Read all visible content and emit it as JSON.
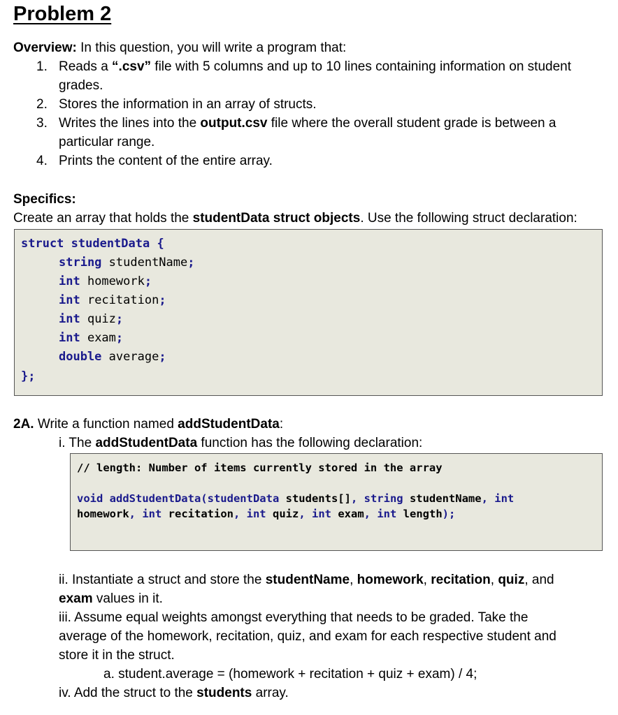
{
  "title": "Problem 2",
  "overview": {
    "label": "Overview:",
    "intro": " In this question, you will write a program that:",
    "items": [
      {
        "num": "1.",
        "pre": "Reads a ",
        "bold": "“.csv”",
        "post": " file with 5 columns and up to 10 lines containing information on student",
        "cont": "grades."
      },
      {
        "num": "2.",
        "text": "Stores the information in an array of structs."
      },
      {
        "num": "3.",
        "pre": "Writes the lines into the ",
        "bold": "output.csv",
        "post": " file where the overall student grade is between a",
        "cont": "particular range."
      },
      {
        "num": "4.",
        "text": "Prints the content of the entire array."
      }
    ]
  },
  "specifics": {
    "label": "Specifics:",
    "pre": "Create an array that holds the ",
    "bold": "studentData struct objects",
    "post": ". Use the following struct declaration:"
  },
  "struct_code": {
    "open_kw": "struct studentData {",
    "fields": [
      {
        "type": "string",
        "name": " studentName",
        "semi": ";"
      },
      {
        "type": "int",
        "name": " homework",
        "semi": ";"
      },
      {
        "type": "int",
        "name": " recitation",
        "semi": ";"
      },
      {
        "type": "int",
        "name": " quiz",
        "semi": ";"
      },
      {
        "type": "int",
        "name": " exam",
        "semi": ";"
      },
      {
        "type": "double",
        "name": " average",
        "semi": ";"
      }
    ],
    "close": "};"
  },
  "part_2a": {
    "label": "2A.",
    "pre": " Write a function named ",
    "bold": "addStudentData",
    "post": ":",
    "i": {
      "pre": "i. The ",
      "bold": "addStudentData",
      "post": " function has the following declaration:"
    },
    "decl_code": {
      "comment": "// length: Number of items currently stored in the array",
      "l1": [
        {
          "t": "void addStudentData(studentData",
          "k": true
        },
        {
          "t": " students[]",
          "k": false
        },
        {
          "t": ", string",
          "k": true
        },
        {
          "t": " studentName",
          "k": false
        },
        {
          "t": ", int",
          "k": true
        }
      ],
      "l2": [
        {
          "t": "homework",
          "k": false
        },
        {
          "t": ", int",
          "k": true
        },
        {
          "t": " recitation",
          "k": false
        },
        {
          "t": ", int",
          "k": true
        },
        {
          "t": " quiz",
          "k": false
        },
        {
          "t": ", int",
          "k": true
        },
        {
          "t": " exam",
          "k": false
        },
        {
          "t": ", int",
          "k": true
        },
        {
          "t": " length",
          "k": false
        },
        {
          "t": ");",
          "k": true
        }
      ]
    },
    "ii": {
      "pre": "ii. Instantiate a struct and store the ",
      "b1": "studentName",
      "s1": ", ",
      "b2": "homework",
      "s2": ", ",
      "b3": "recitation",
      "s3": ", ",
      "b4": "quiz",
      "s4": ", and",
      "b5": "exam",
      "post": " values in it."
    },
    "iii": {
      "l1": "iii. Assume equal weights amongst everything that needs to be graded. Take the",
      "l2": "average of the homework, recitation, quiz, and exam for each respective student and",
      "l3": "store it in the struct.",
      "a": "a. student.average = (homework + recitation + quiz + exam) / 4;"
    },
    "iv": {
      "pre": "iv. Add the struct to the ",
      "bold": "students",
      "post": " array."
    }
  }
}
